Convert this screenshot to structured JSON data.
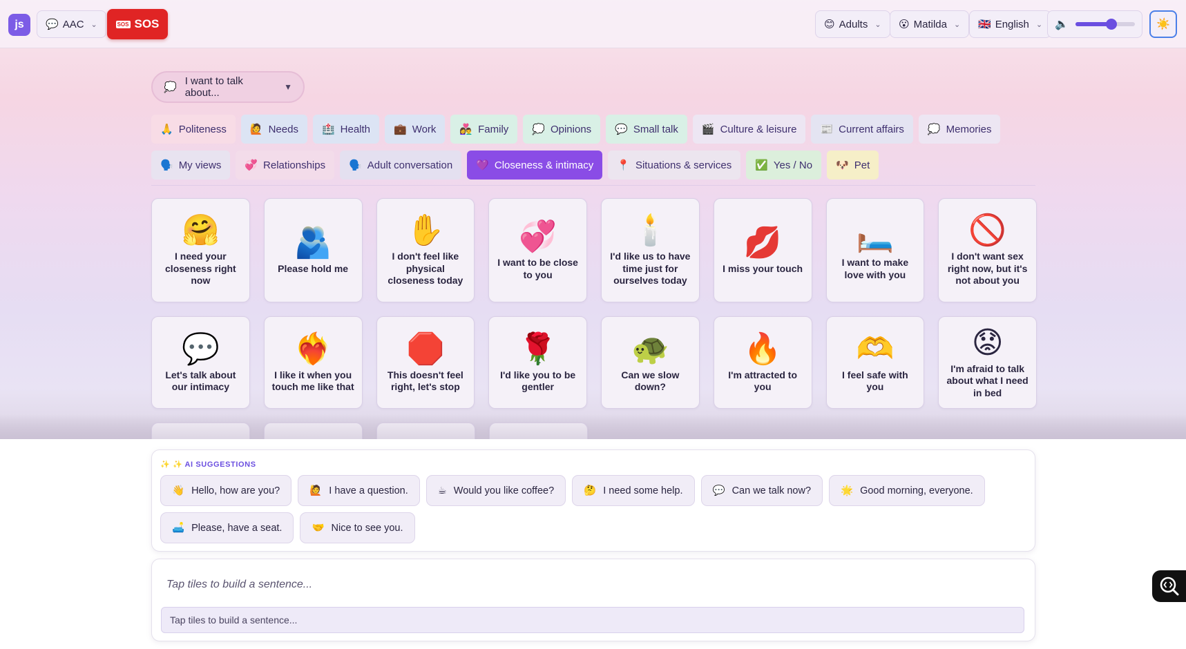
{
  "topbar": {
    "logo_text": "js",
    "mode": {
      "icon": "💬",
      "label": "AAC"
    },
    "sos": {
      "tag": "SOS",
      "label": "SOS"
    },
    "audience": {
      "icon": "😊",
      "label": "Adults"
    },
    "user": {
      "icon": "😮",
      "label": "Matilda"
    },
    "language": {
      "icon": "🇬🇧",
      "label": "English"
    },
    "volume": {
      "icon": "🔈",
      "level_percent": 60
    },
    "theme_icon": "☀️"
  },
  "topic": {
    "icon": "💭",
    "label": "I want to talk about...",
    "arrow": "▼"
  },
  "categories": {
    "row1": [
      {
        "icon": "🙏",
        "label": "Politeness",
        "bg": "#f8dce6"
      },
      {
        "icon": "🙋",
        "label": "Needs",
        "bg": "#dce4f4"
      },
      {
        "icon": "🏥",
        "label": "Health",
        "bg": "#dce4f4"
      },
      {
        "icon": "💼",
        "label": "Work",
        "bg": "#dce4f4"
      },
      {
        "icon": "👩‍❤️‍👨",
        "label": "Family",
        "bg": "#d9f0e6"
      },
      {
        "icon": "💭",
        "label": "Opinions",
        "bg": "#d9f0e6"
      },
      {
        "icon": "💬",
        "label": "Small talk",
        "bg": "#d9f0e6"
      },
      {
        "icon": "🎬",
        "label": "Culture & leisure",
        "bg": "#ede6f3"
      },
      {
        "icon": "📰",
        "label": "Current affairs",
        "bg": "#e4e4f2"
      },
      {
        "icon": "💭",
        "label": "Memories",
        "bg": "#ede6f3"
      }
    ],
    "row2": [
      {
        "icon": "🗣️",
        "label": "My views",
        "bg": "#e8e3f0"
      },
      {
        "icon": "💞",
        "label": "Relationships",
        "bg": "#f3dcea"
      },
      {
        "icon": "🗣️",
        "label": "Adult conversation",
        "bg": "#e4e0f0"
      },
      {
        "icon": "💜",
        "label": "Closeness & intimacy",
        "bg": "#8a4ce6",
        "active": true
      },
      {
        "icon": "📍",
        "label": "Situations & services",
        "bg": "#ece5ef"
      },
      {
        "icon": "✅",
        "label": "Yes / No",
        "bg": "#dcefdc"
      },
      {
        "icon": "🐶",
        "label": "Pet",
        "bg": "#f6efc8"
      }
    ]
  },
  "tiles": {
    "row1": [
      {
        "emoji": "🤗",
        "label": "I need your closeness right now"
      },
      {
        "emoji": "🫂",
        "label": "Please hold me"
      },
      {
        "emoji": "✋",
        "label": "I don't feel like physical closeness today"
      },
      {
        "emoji": "💞",
        "label": "I want to be close to you"
      },
      {
        "emoji": "🕯️",
        "label": "I'd like us to have time just for ourselves today"
      },
      {
        "emoji": "💋",
        "label": "I miss your touch"
      },
      {
        "emoji": "🛏️",
        "label": "I want to make love with you"
      },
      {
        "emoji": "🚫",
        "label": "I don't want sex right now, but it's not about you"
      }
    ],
    "row2": [
      {
        "emoji": "💬",
        "label": "Let's talk about our intimacy"
      },
      {
        "emoji": "❤️‍🔥",
        "label": "I like it when you touch me like that"
      },
      {
        "emoji": "🛑",
        "label": "This doesn't feel right, let's stop"
      },
      {
        "emoji": "🌹",
        "label": "I'd like you to be gentler"
      },
      {
        "emoji": "🐢",
        "label": "Can we slow down?"
      },
      {
        "emoji": "🔥",
        "label": "I'm attracted to you"
      },
      {
        "emoji": "🫶",
        "label": "I feel safe with you"
      },
      {
        "emoji": "😟",
        "label": "I'm afraid to talk about what I need in bed"
      }
    ]
  },
  "ai": {
    "title": "✨ ✨ AI SUGGESTIONS",
    "row1": [
      {
        "icon": "👋",
        "label": "Hello, how are you?"
      },
      {
        "icon": "🙋",
        "label": "I have a question."
      },
      {
        "icon": "☕",
        "label": "Would you like coffee?"
      },
      {
        "icon": "🤔",
        "label": "I need some help."
      },
      {
        "icon": "💬",
        "label": "Can we talk now?"
      },
      {
        "icon": "🌟",
        "label": "Good morning, everyone."
      }
    ],
    "row2": [
      {
        "icon": "🛋️",
        "label": "Please, have a seat."
      },
      {
        "icon": "🤝",
        "label": "Nice to see you."
      }
    ]
  },
  "sentence": {
    "display_placeholder": "Tap tiles to build a sentence...",
    "input_placeholder": "Tap tiles to build a sentence..."
  }
}
